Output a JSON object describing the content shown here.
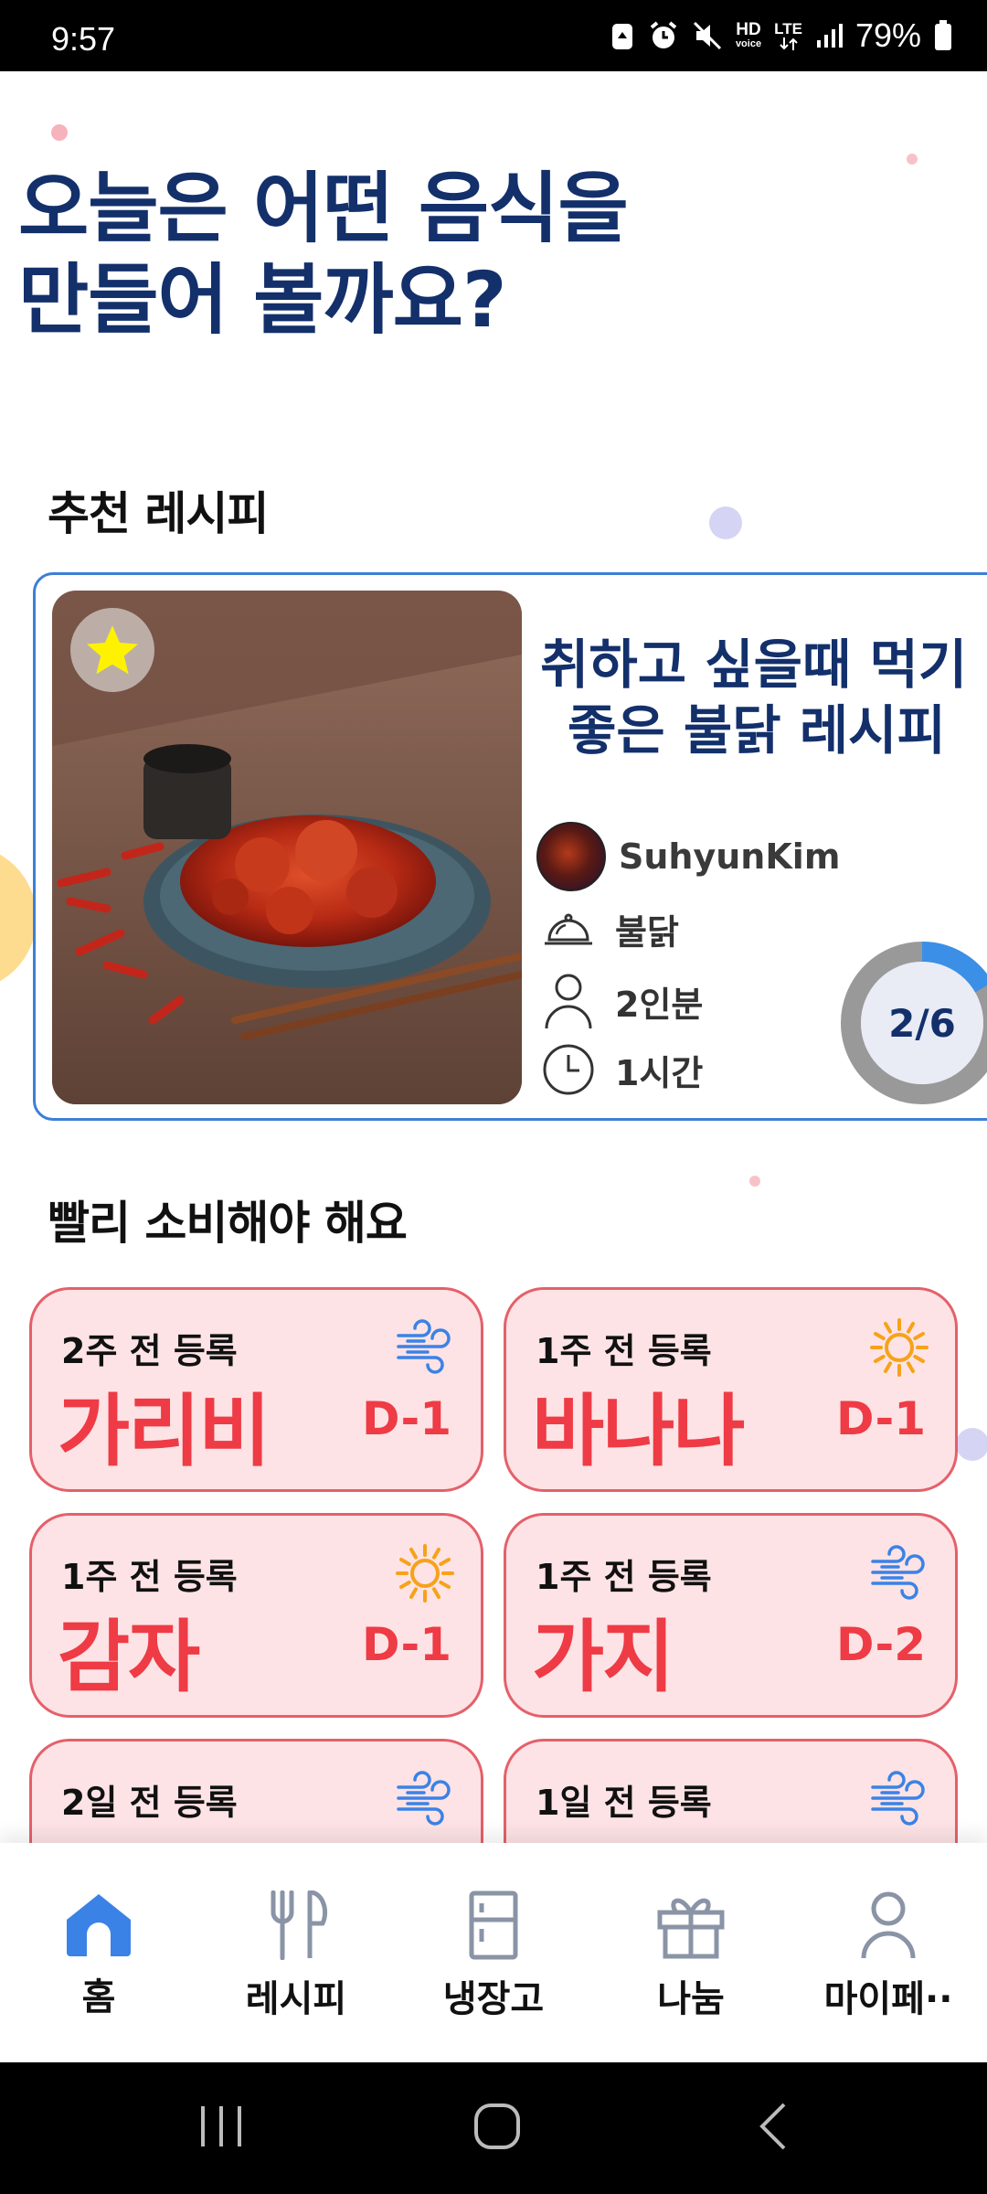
{
  "status_bar": {
    "time": "9:57",
    "battery": "79%",
    "icons": [
      "recycle-icon",
      "alarm-icon",
      "mute-icon",
      "hd-voice-icon",
      "lte-icon",
      "signal-icon",
      "battery-icon"
    ],
    "hd": "HD",
    "voice": "voice",
    "lte": "LTE"
  },
  "headline": {
    "line1": "오늘은 어떤 음식을",
    "line2": "만들어 볼까요?"
  },
  "recommended": {
    "section_title": "추천 레시피",
    "recipe": {
      "title_line1": "취하고 싶을때 먹기",
      "title_line2": "좋은 불닭 레시피",
      "author": "SuhyunKim",
      "category": "불닭",
      "servings": "2인분",
      "time": "1시간",
      "progress_label": "2/6",
      "progress_fraction": 0.1667,
      "favorite": true
    }
  },
  "expiring": {
    "section_title": "빨리 소비해야 해요",
    "items": [
      {
        "registered": "2주 전 등록",
        "name": "가리비",
        "dday": "D-1",
        "icon": "wind-icon"
      },
      {
        "registered": "1주 전 등록",
        "name": "바나나",
        "dday": "D-1",
        "icon": "sun-icon"
      },
      {
        "registered": "1주 전 등록",
        "name": "감자",
        "dday": "D-1",
        "icon": "sun-icon"
      },
      {
        "registered": "1주 전 등록",
        "name": "가지",
        "dday": "D-2",
        "icon": "wind-icon"
      },
      {
        "registered": "2일 전 등록",
        "name": "",
        "dday": "",
        "icon": "wind-icon"
      },
      {
        "registered": "1일 전 등록",
        "name": "",
        "dday": "",
        "icon": "wind-icon"
      }
    ]
  },
  "bottom_nav": [
    {
      "label": "홈",
      "icon": "home-icon",
      "active": true
    },
    {
      "label": "레시피",
      "icon": "fork-knife-icon",
      "active": false
    },
    {
      "label": "냉장고",
      "icon": "fridge-icon",
      "active": false
    },
    {
      "label": "나눔",
      "icon": "gift-icon",
      "active": false
    },
    {
      "label": "마이페··",
      "icon": "person-icon",
      "active": false
    }
  ],
  "colors": {
    "primary_navy": "#13306b",
    "accent_blue": "#3d7fd6",
    "card_pink": "#fde3e5",
    "card_red": "#ee3b45",
    "active_nav": "#3b82e6"
  }
}
